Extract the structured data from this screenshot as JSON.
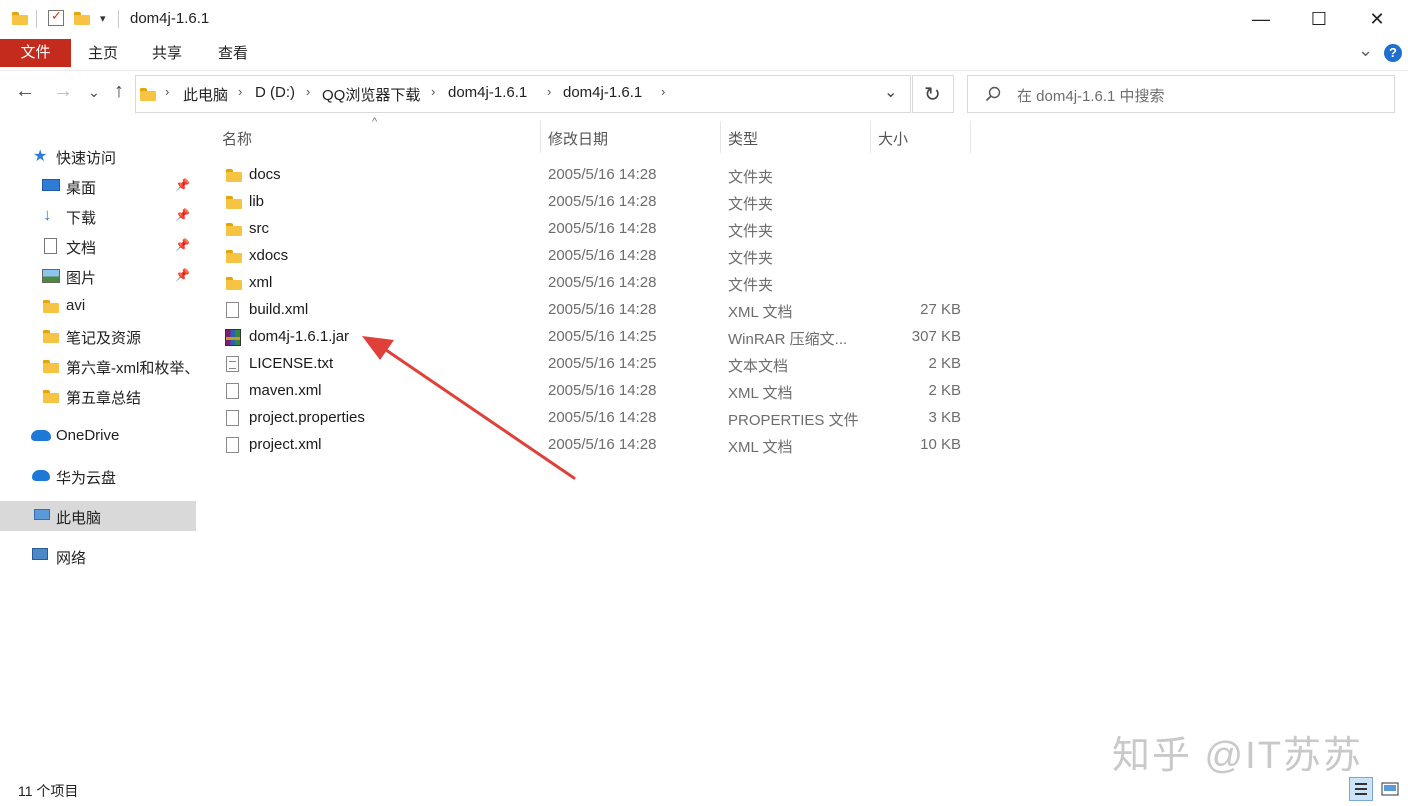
{
  "window": {
    "title": "dom4j-1.6.1",
    "minimize_glyph": "—",
    "maximize_glyph": "☐",
    "close_glyph": "✕"
  },
  "ribbon": {
    "tabs": [
      "文件",
      "主页",
      "共享",
      "查看"
    ],
    "expand_glyph": "⌄",
    "help_glyph": "?"
  },
  "address": {
    "back_glyph": "←",
    "forward_glyph": "→",
    "recent_glyph": "⌄",
    "up_glyph": "↑",
    "breadcrumbs": [
      "此电脑",
      "D (D:)",
      "QQ浏览器下载",
      "dom4j-1.6.1",
      "dom4j-1.6.1"
    ],
    "dropdown_glyph": "⌄",
    "refresh_glyph": "↻",
    "search_placeholder": "在 dom4j-1.6.1 中搜索"
  },
  "sidebar": {
    "items": [
      {
        "label": "快速访问",
        "icon": "star-icon",
        "pinned": false
      },
      {
        "label": "桌面",
        "icon": "desktop-icon",
        "pinned": true
      },
      {
        "label": "下载",
        "icon": "download-icon",
        "pinned": true
      },
      {
        "label": "文档",
        "icon": "document-icon",
        "pinned": true
      },
      {
        "label": "图片",
        "icon": "pictures-icon",
        "pinned": true
      },
      {
        "label": "avi",
        "icon": "folder-icon",
        "pinned": false
      },
      {
        "label": "笔记及资源",
        "icon": "folder-icon",
        "pinned": false
      },
      {
        "label": "第六章-xml和枚举、",
        "icon": "folder-icon",
        "pinned": false
      },
      {
        "label": "第五章总结",
        "icon": "folder-icon",
        "pinned": false
      },
      {
        "label": "OneDrive",
        "icon": "cloud-icon",
        "pinned": false
      },
      {
        "label": "华为云盘",
        "icon": "cloud-icon",
        "pinned": false
      },
      {
        "label": "此电脑",
        "icon": "computer-icon",
        "pinned": false
      },
      {
        "label": "网络",
        "icon": "network-icon",
        "pinned": false
      }
    ],
    "selected": "此电脑"
  },
  "list": {
    "columns": [
      "名称",
      "修改日期",
      "类型",
      "大小"
    ],
    "sort_glyph": "^",
    "rows": [
      {
        "name": "docs",
        "date": "2005/5/16 14:28",
        "type": "文件夹",
        "size": "",
        "icon": "folder-icon"
      },
      {
        "name": "lib",
        "date": "2005/5/16 14:28",
        "type": "文件夹",
        "size": "",
        "icon": "folder-icon"
      },
      {
        "name": "src",
        "date": "2005/5/16 14:28",
        "type": "文件夹",
        "size": "",
        "icon": "folder-icon"
      },
      {
        "name": "xdocs",
        "date": "2005/5/16 14:28",
        "type": "文件夹",
        "size": "",
        "icon": "folder-icon"
      },
      {
        "name": "xml",
        "date": "2005/5/16 14:28",
        "type": "文件夹",
        "size": "",
        "icon": "folder-icon"
      },
      {
        "name": "build.xml",
        "date": "2005/5/16 14:28",
        "type": "XML 文档",
        "size": "27 KB",
        "icon": "file-icon"
      },
      {
        "name": "dom4j-1.6.1.jar",
        "date": "2005/5/16 14:25",
        "type": "WinRAR 压缩文...",
        "size": "307 KB",
        "icon": "winrar-archive-icon"
      },
      {
        "name": "LICENSE.txt",
        "date": "2005/5/16 14:25",
        "type": "文本文档",
        "size": "2 KB",
        "icon": "text-file-icon"
      },
      {
        "name": "maven.xml",
        "date": "2005/5/16 14:28",
        "type": "XML 文档",
        "size": "2 KB",
        "icon": "file-icon"
      },
      {
        "name": "project.properties",
        "date": "2005/5/16 14:28",
        "type": "PROPERTIES 文件",
        "size": "3 KB",
        "icon": "file-icon"
      },
      {
        "name": "project.xml",
        "date": "2005/5/16 14:28",
        "type": "XML 文档",
        "size": "10 KB",
        "icon": "file-icon"
      }
    ]
  },
  "status": {
    "item_count": "11 个项目"
  },
  "watermark": "知乎 @IT苏苏",
  "colors": {
    "file_tab": "#c42b1c",
    "annotation_arrow": "#e0403a",
    "selected_bg": "#d9d9d9"
  }
}
